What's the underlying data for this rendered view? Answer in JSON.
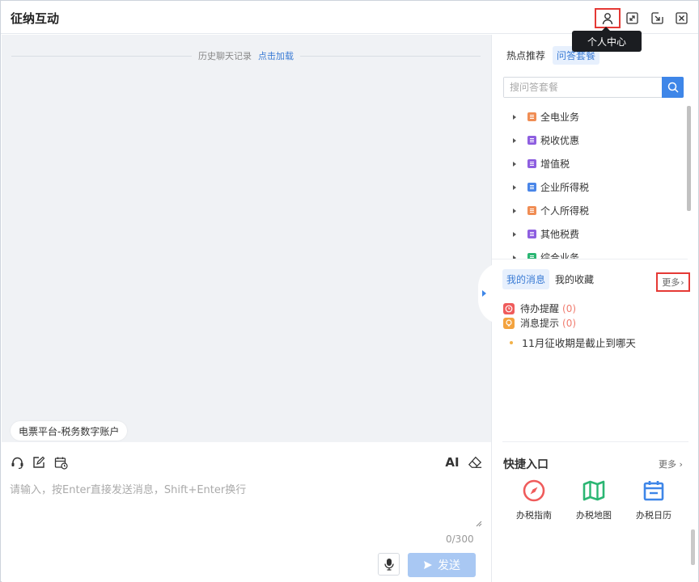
{
  "window": {
    "title": "征纳互动"
  },
  "titlebar": {
    "tooltip": "个人中心",
    "buttons": [
      "user-icon",
      "maximize-icon",
      "minimize-icon",
      "close-icon"
    ]
  },
  "chat": {
    "history_label": "历史聊天记录",
    "history_link": "点击加载",
    "context_chip": "电票平台-税务数字账户"
  },
  "input": {
    "placeholder": "请输入，按Enter直接发送消息，Shift+Enter换行",
    "value": "",
    "counter": "0/300",
    "ai_label": "AI",
    "send_label": "发送"
  },
  "right_panel": {
    "tabs": [
      {
        "label": "热点推荐",
        "active": false
      },
      {
        "label": "问答套餐",
        "active": true
      }
    ],
    "search_placeholder": "搜问答套餐",
    "tree": [
      {
        "label": "全电业务",
        "color": "#f08d54"
      },
      {
        "label": "税收优惠",
        "color": "#8e5fe0"
      },
      {
        "label": "增值税",
        "color": "#8e5fe0"
      },
      {
        "label": "企业所得税",
        "color": "#4a86e8"
      },
      {
        "label": "个人所得税",
        "color": "#f08d54"
      },
      {
        "label": "其他税费",
        "color": "#8e5fe0"
      },
      {
        "label": "综合业务",
        "color": "#2bb673"
      }
    ],
    "msg_tabs": [
      {
        "label": "我的消息",
        "active": true
      },
      {
        "label": "我的收藏",
        "active": false
      }
    ],
    "msg_more": "更多",
    "messages": [
      {
        "label": "待办提醒",
        "count": "(0)",
        "color": "#ef5b5b"
      },
      {
        "label": "消息提示",
        "count": "(0)",
        "color": "#f3a33f"
      }
    ],
    "notice": "11月征收期是截止到哪天",
    "quick": {
      "title": "快捷入口",
      "more": "更多",
      "items": [
        {
          "label": "办税指南",
          "icon": "compass-icon",
          "color": "#ef5b5b"
        },
        {
          "label": "办税地图",
          "icon": "map-icon",
          "color": "#2bb673"
        },
        {
          "label": "办税日历",
          "icon": "calendar-icon",
          "color": "#3e86e8"
        }
      ]
    }
  }
}
